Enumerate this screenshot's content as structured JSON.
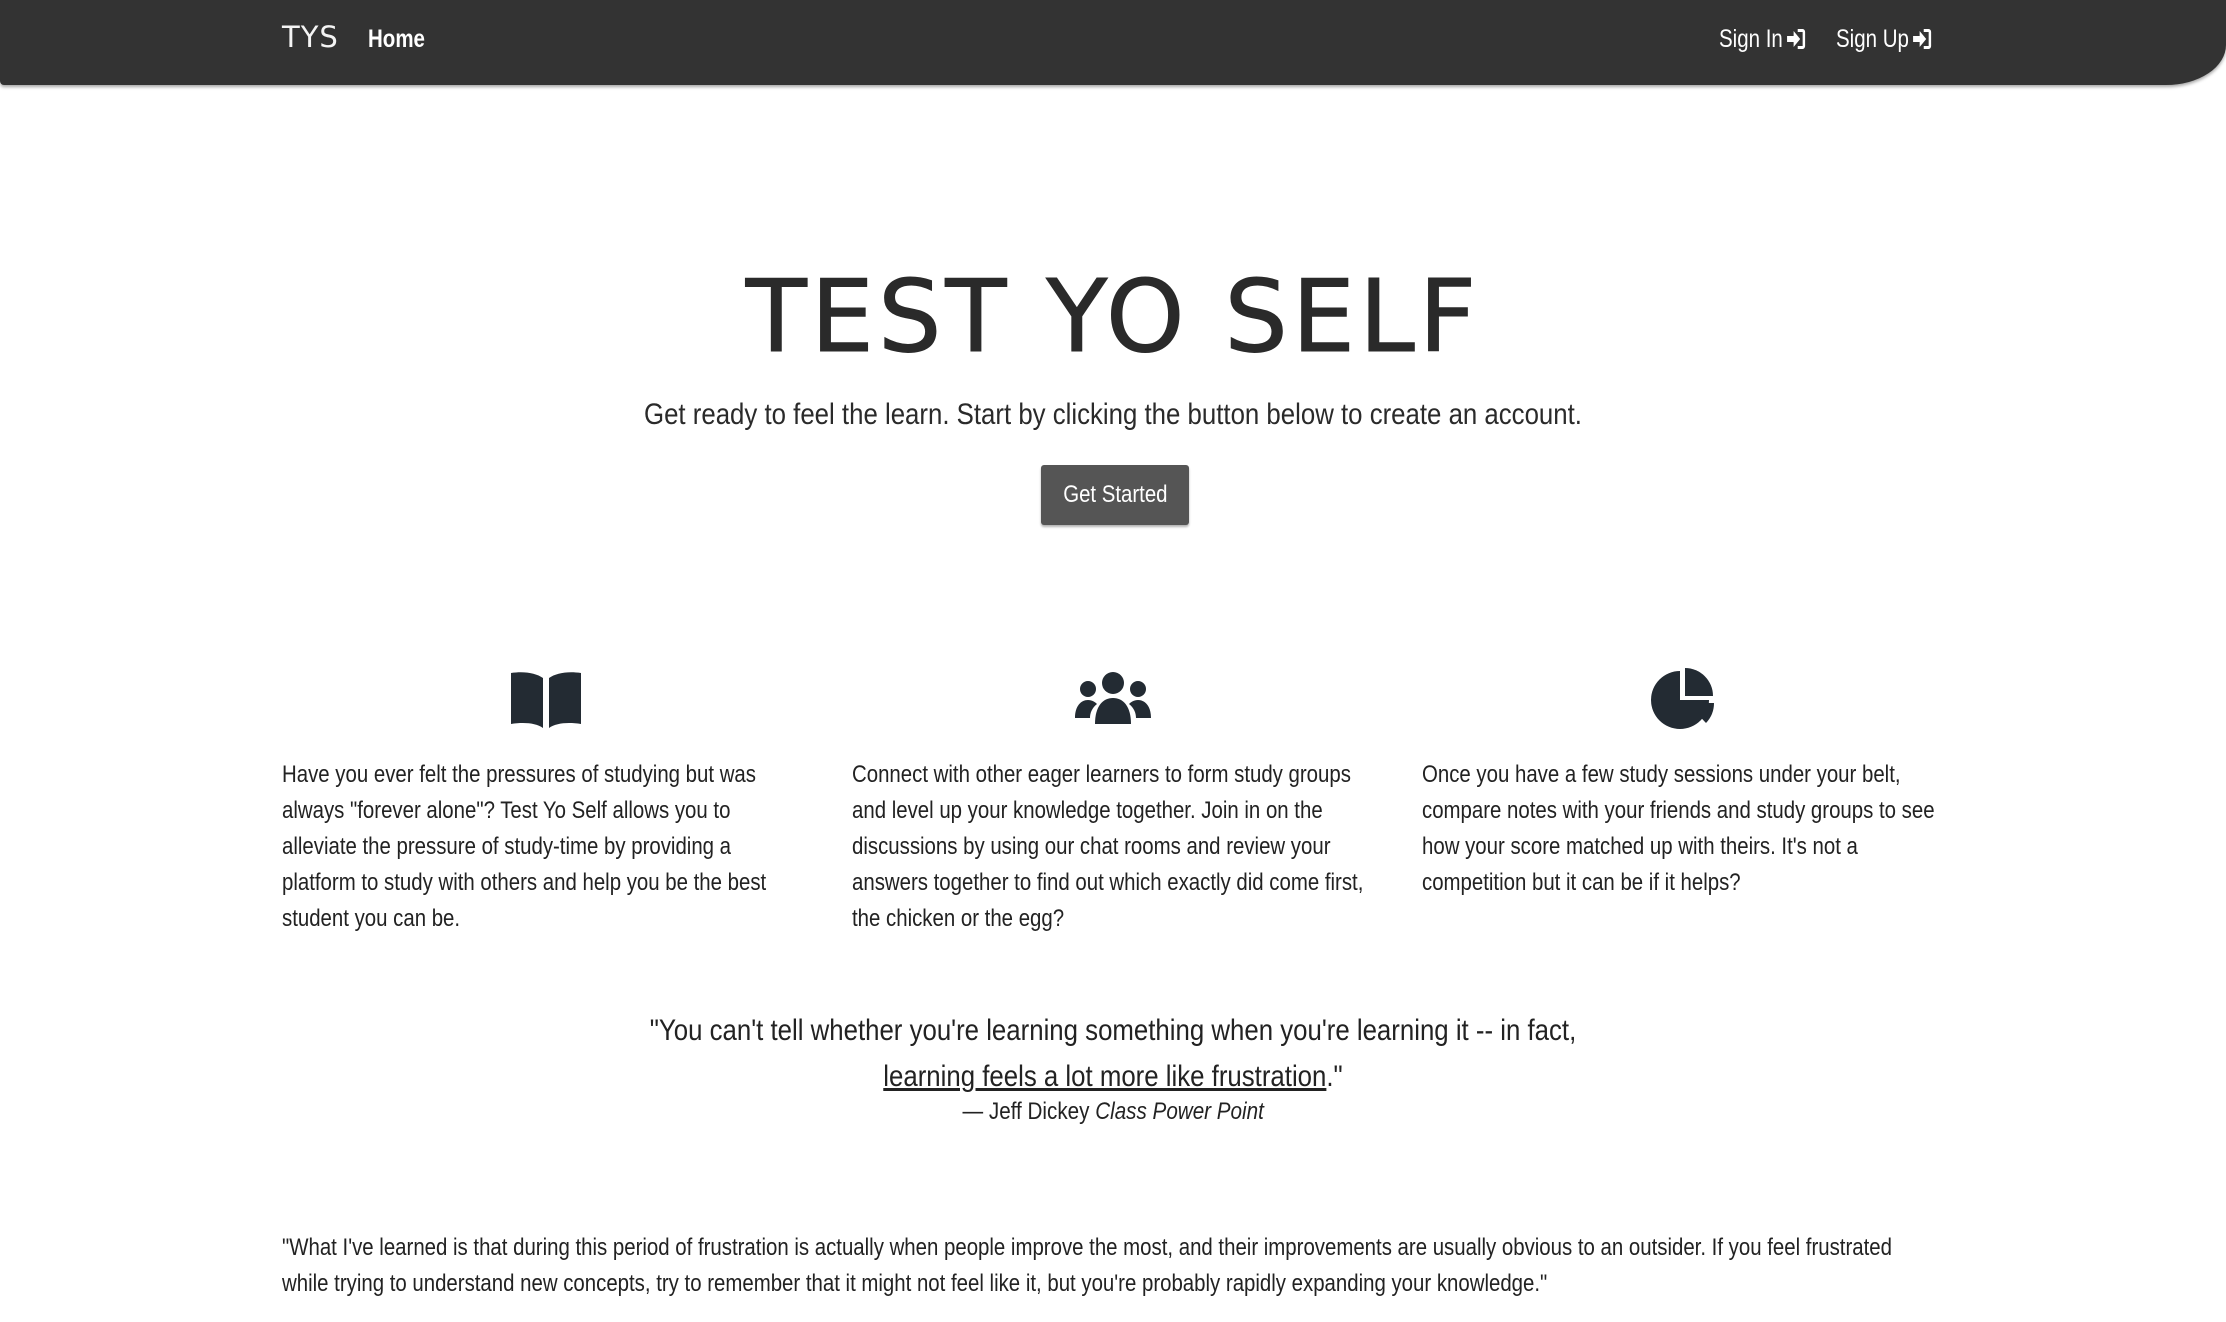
{
  "navbar": {
    "brand": "TYS",
    "home_label": "Home",
    "signin_label": "Sign In",
    "signup_label": "Sign Up",
    "signin_icon": "sign-in-icon",
    "signup_icon": "sign-in-icon"
  },
  "hero": {
    "title": "TEST YO SELF",
    "subtitle": "Get ready to feel the learn. Start by clicking the button below to create an account.",
    "cta_label": "Get Started"
  },
  "features": [
    {
      "icon": "book-open-icon",
      "text": "Have you ever felt the pressures of studying but was always \"forever alone\"? Test Yo Self allows you to alleviate the pressure of study-time by providing a platform to study with others and help you be the best student you can be."
    },
    {
      "icon": "users-group-icon",
      "text": "Connect with other eager learners to form study groups and level up your knowledge together. Join in on the discussions by using our chat rooms and review your answers together to find out which exactly did come first, the chicken or the egg?"
    },
    {
      "icon": "pie-chart-icon",
      "text": "Once you have a few study sessions under your belt, compare notes with your friends and study groups to see how your score matched up with theirs. It's not a competition but it can be if it helps?"
    }
  ],
  "quote": {
    "line1": "\"You can't tell whether you're learning something when you're learning it -- in fact,",
    "line2_underlined": "learning feels a lot more like frustration",
    "line2_end": ".\"",
    "author": "— Jeff Dickey",
    "source": "Class Power Point"
  },
  "bottom_paragraph": "\"What I've learned is that during this period of frustration is actually when people improve the most, and their improvements are usually obvious to an outsider. If you feel frustrated while trying to understand new concepts, try to remember that it might not feel like it, but you're probably rapidly expanding your knowledge.\"",
  "colors": {
    "navbar_bg": "#333333",
    "button_bg": "#555555",
    "text": "#222222"
  }
}
